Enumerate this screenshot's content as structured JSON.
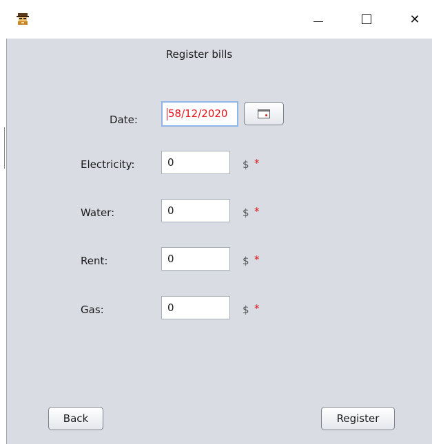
{
  "window": {
    "icon": "spy-character-icon",
    "controls": {
      "minimize": "minimize-icon",
      "maximize": "maximize-icon",
      "close_glyph": "✕"
    }
  },
  "form": {
    "heading": "Register bills",
    "date": {
      "label": "Date:",
      "value": "58/12/2020",
      "picker_icon": "calendar-icon"
    },
    "fields": [
      {
        "label": "Electricity:",
        "value": "0",
        "currency": "$",
        "required": "*"
      },
      {
        "label": "Water:",
        "value": "0",
        "currency": "$",
        "required": "*"
      },
      {
        "label": "Rent:",
        "value": "0",
        "currency": "$",
        "required": "*"
      },
      {
        "label": "Gas:",
        "value": "0",
        "currency": "$",
        "required": "*"
      }
    ]
  },
  "buttons": {
    "back": "Back",
    "register": "Register"
  },
  "colors": {
    "panel_bg": "#d9dce3",
    "required": "#e0141a",
    "focus_border": "#8fb4e6"
  }
}
